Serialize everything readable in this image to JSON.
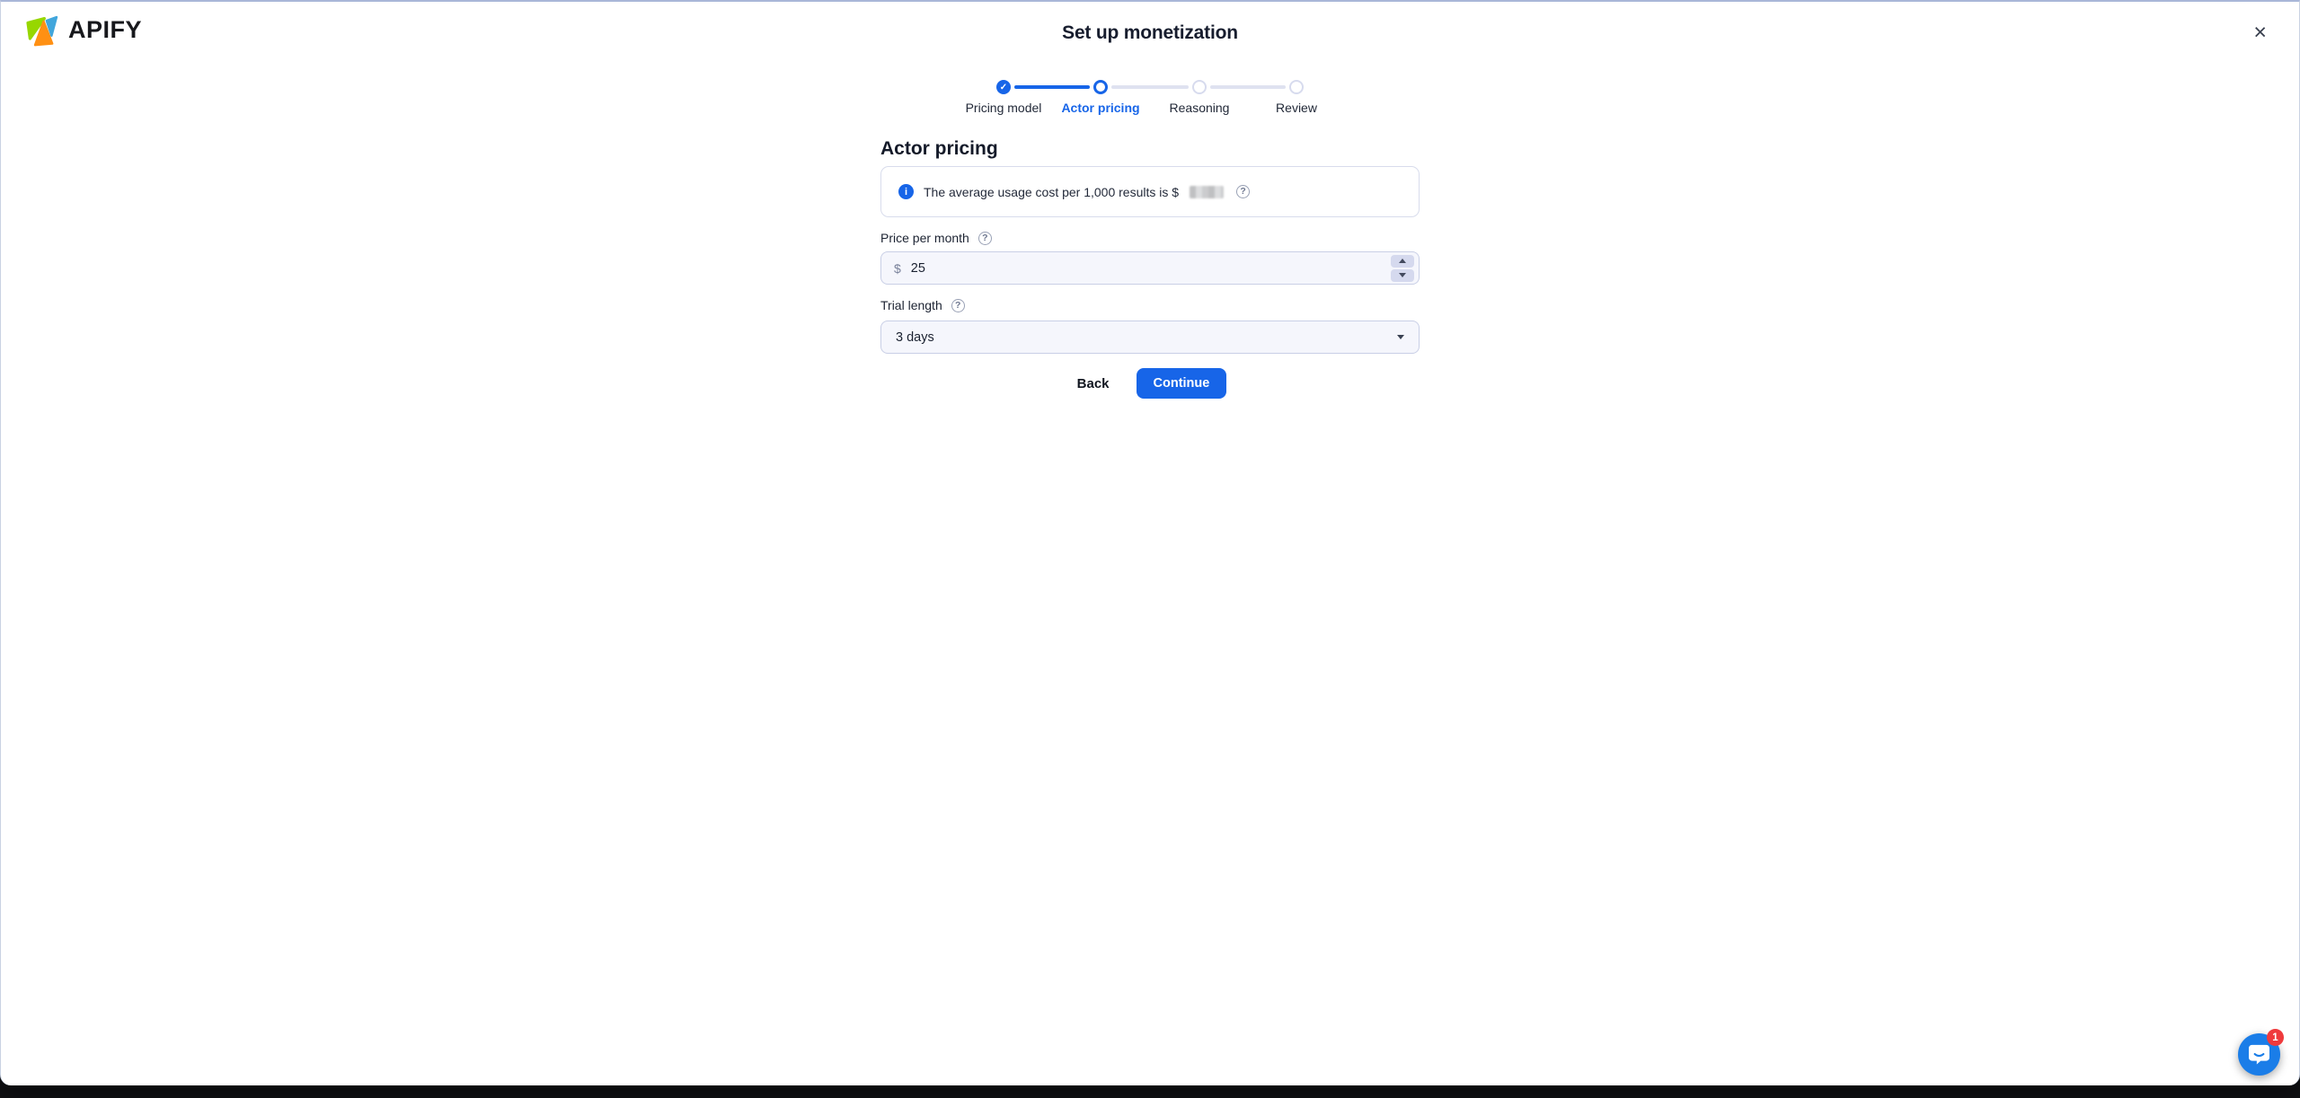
{
  "header": {
    "logo_text": "APIFY",
    "title": "Set up monetization",
    "close_label": "×"
  },
  "stepper": {
    "check_glyph": "✓",
    "steps": [
      {
        "label": "Pricing model",
        "state": "completed"
      },
      {
        "label": "Actor pricing",
        "state": "active"
      },
      {
        "label": "Reasoning",
        "state": "upcoming"
      },
      {
        "label": "Review",
        "state": "upcoming"
      }
    ]
  },
  "form": {
    "heading": "Actor pricing",
    "info_banner": {
      "info_glyph": "i",
      "text": "The average usage cost per 1,000 results is $",
      "value_redacted": true,
      "help_glyph": "?"
    },
    "price_field": {
      "label": "Price per month",
      "help_glyph": "?",
      "currency_prefix": "$",
      "value": "25"
    },
    "trial_field": {
      "label": "Trial length",
      "help_glyph": "?",
      "value": "3 days"
    }
  },
  "actions": {
    "back_label": "Back",
    "continue_label": "Continue"
  },
  "chat_widget": {
    "badge_count": "1"
  },
  "colors": {
    "accent_blue": "#1765e8",
    "inactive_step": "#dfe2f0",
    "input_background": "#f5f6fc",
    "input_border": "#c9cfe6",
    "dark_text": "#1b2232",
    "top_edge_line": "#a9b7d8",
    "page_backdrop": "#101114",
    "chat_blue": "#1a7de8",
    "badge_red": "#ef3a3c",
    "logo_green": "#97d700",
    "logo_orange": "#ff9013",
    "logo_blue": "#41a6dc"
  }
}
